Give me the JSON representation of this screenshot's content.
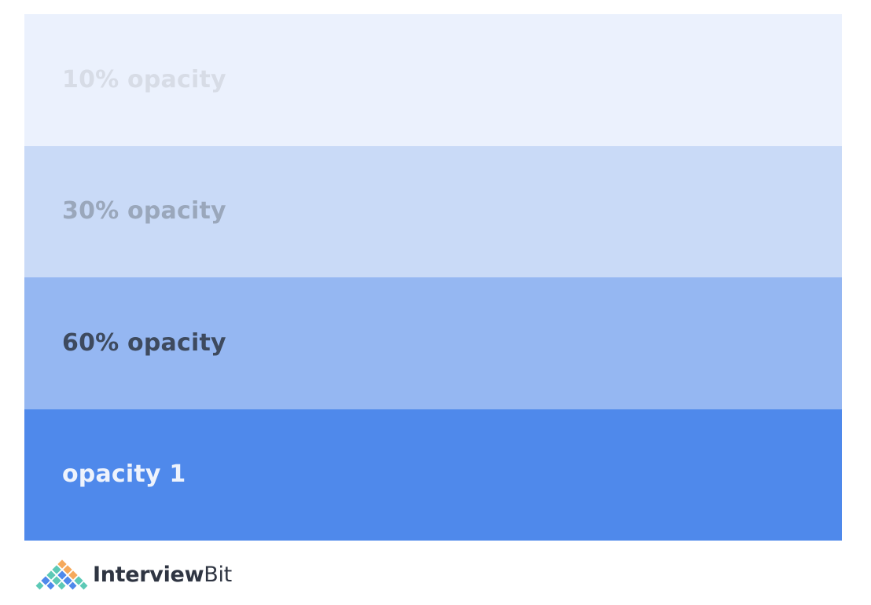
{
  "bands": [
    {
      "label": "10% opacity",
      "opacity": 0.1,
      "color": "#ebf1fd"
    },
    {
      "label": "30% opacity",
      "opacity": 0.3,
      "color": "#c9daf7"
    },
    {
      "label": "60% opacity",
      "opacity": 0.6,
      "color": "#95b7f2"
    },
    {
      "label": "opacity 1",
      "opacity": 1,
      "color": "#4f89eb"
    }
  ],
  "logo": {
    "name_bold": "Interview",
    "name_light": "Bit",
    "icon": "diamond-lattice-logo-icon",
    "colors": [
      "#f5a95b",
      "#5dc9b6",
      "#4f89eb"
    ]
  }
}
